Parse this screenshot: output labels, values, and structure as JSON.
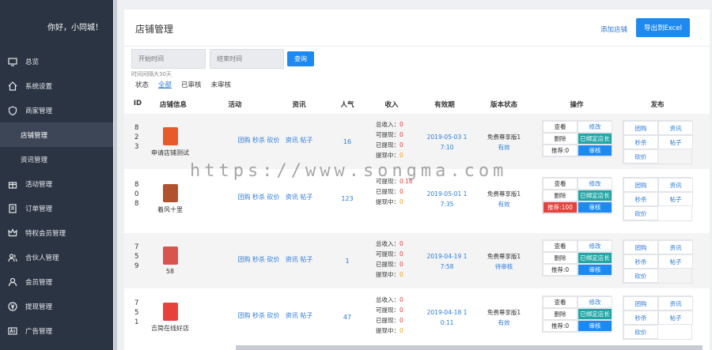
{
  "greeting": "你好，小同城！",
  "menu": [
    {
      "icon": "monitor-icon",
      "label": "总览"
    },
    {
      "icon": "home-icon",
      "label": "系统设置"
    },
    {
      "icon": "shield-icon",
      "label": "商家管理"
    },
    {
      "icon": "",
      "label": "店铺管理",
      "active": true
    },
    {
      "icon": "",
      "label": "资讯管理"
    },
    {
      "icon": "gift-icon",
      "label": "活动管理"
    },
    {
      "icon": "document-icon",
      "label": "订单管理"
    },
    {
      "icon": "crown-icon",
      "label": "特权会员管理"
    },
    {
      "icon": "users-icon",
      "label": "合伙人管理"
    },
    {
      "icon": "user-icon",
      "label": "会员管理"
    },
    {
      "icon": "yen-icon",
      "label": "提现管理"
    },
    {
      "icon": "ad-icon",
      "label": "广告管理"
    }
  ],
  "page": {
    "title": "店铺管理",
    "add_link": "添加店铺",
    "export_button": "导出到Excel",
    "start_placeholder": "开始时间",
    "end_placeholder": "结束时间",
    "search_button": "查询",
    "hint": "时间间隔大30天",
    "status_label": "状态",
    "status_tabs": [
      "全部",
      "已审核",
      "未审核"
    ]
  },
  "columns": [
    "ID",
    "店铺信息",
    "活动",
    "资讯",
    "人气",
    "收入",
    "有效期",
    "版本状态",
    "操作",
    "发布"
  ],
  "rows": [
    {
      "id": "823",
      "name": "申请店铺测试",
      "thumb": "#e85a2a",
      "activity": "团购 秒杀 砍价",
      "news": "资讯 帖子",
      "pop": "16",
      "income": [
        [
          "总收入：",
          "0"
        ],
        [
          "可提现：",
          "0"
        ],
        [
          "已提现：",
          "0"
        ],
        [
          "提现中：",
          "0"
        ]
      ],
      "valid": [
        "2019-05-03 1",
        "7:10"
      ],
      "ver": [
        "免费尊享版1",
        "有效"
      ],
      "ops": [
        "查看",
        "修改",
        "删除",
        "已绑定店长",
        "推荐:0",
        "审核"
      ],
      "rec_red": false
    },
    {
      "id": "808",
      "name": "着风十里",
      "thumb": "#b0522e",
      "activity": "团购 秒杀 砍价",
      "news": "资讯 帖子",
      "pop": "123",
      "income": [
        [
          "可提现：",
          "0.16"
        ],
        [
          "已提现：",
          "0"
        ],
        [
          "提现中：",
          "0"
        ]
      ],
      "valid": [
        "2019-05-01 1",
        "7:35"
      ],
      "ver": [
        "免费尊享版1",
        "有效"
      ],
      "ops": [
        "查看",
        "修改",
        "删除",
        "已绑定店长",
        "推荐:100",
        "审核"
      ],
      "rec_red": true
    },
    {
      "id": "759",
      "name": "58",
      "thumb": "#d9534f",
      "activity": "团购 秒杀 砍价",
      "news": "资讯 帖子",
      "pop": "1",
      "income": [
        [
          "总收入：",
          "0"
        ],
        [
          "可提现：",
          "0"
        ],
        [
          "已提现：",
          "0"
        ],
        [
          "提现中：",
          "0"
        ]
      ],
      "valid": [
        "2019-04-19 1",
        "7:58"
      ],
      "ver": [
        "免费尊享版1",
        "待审核"
      ],
      "ops": [
        "查看",
        "修改",
        "删除",
        "已绑定店长",
        "推荐:0",
        "审核"
      ],
      "rec_red": false
    },
    {
      "id": "751",
      "name": "吉简在线好店",
      "thumb": "#e8403a",
      "activity": "团购 秒杀 砍价",
      "news": "资讯 帖子",
      "pop": "47",
      "income": [
        [
          "总收入：",
          "0"
        ],
        [
          "可提现：",
          "0"
        ],
        [
          "已提现：",
          "0"
        ],
        [
          "提现中：",
          "0"
        ]
      ],
      "valid": [
        "2019-04-18 1",
        "0:11"
      ],
      "ver": [
        "免费尊享版1",
        "有效"
      ],
      "ops": [
        "查看",
        "修改",
        "删除",
        "已绑定店长",
        "推荐:0",
        "审核"
      ],
      "rec_red": false
    }
  ],
  "publish": [
    "团购",
    "资讯",
    "秒杀",
    "帖子",
    "砍价"
  ],
  "watermark": "https://www.songma.com"
}
